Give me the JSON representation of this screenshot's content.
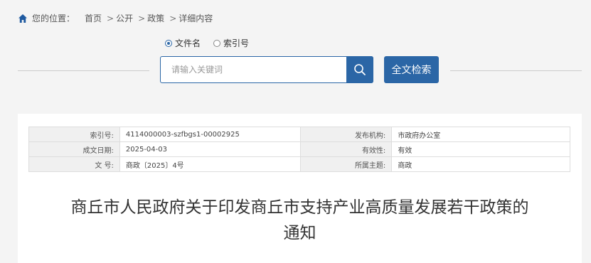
{
  "breadcrumb": {
    "location_label": "您的位置：",
    "items": [
      "首页",
      "公开",
      "政策",
      "详细内容"
    ],
    "separator": ">"
  },
  "search": {
    "options": [
      {
        "label": "文件名",
        "checked": true
      },
      {
        "label": "索引号",
        "checked": false
      }
    ],
    "placeholder": "请输入关键词",
    "fulltext_label": "全文检索"
  },
  "meta": {
    "rows": [
      {
        "l1": "索引号:",
        "v1": "4114000003-szfbgs1-00002925",
        "l2": "发布机构:",
        "v2": "市政府办公室"
      },
      {
        "l1": "成文日期:",
        "v1": "2025-04-03",
        "l2": "有效性:",
        "v2": "有效"
      },
      {
        "l1": "文   号:",
        "v1": "商政〔2025〕4号",
        "l2": "所属主题:",
        "v2": "商政"
      }
    ]
  },
  "document": {
    "title_line1": "商丘市人民政府关于印发商丘市支持产业高质量发展若干政策的",
    "title_line2": "通知"
  },
  "colors": {
    "accent": "#2b66a6",
    "background": "#f4f4f4"
  }
}
